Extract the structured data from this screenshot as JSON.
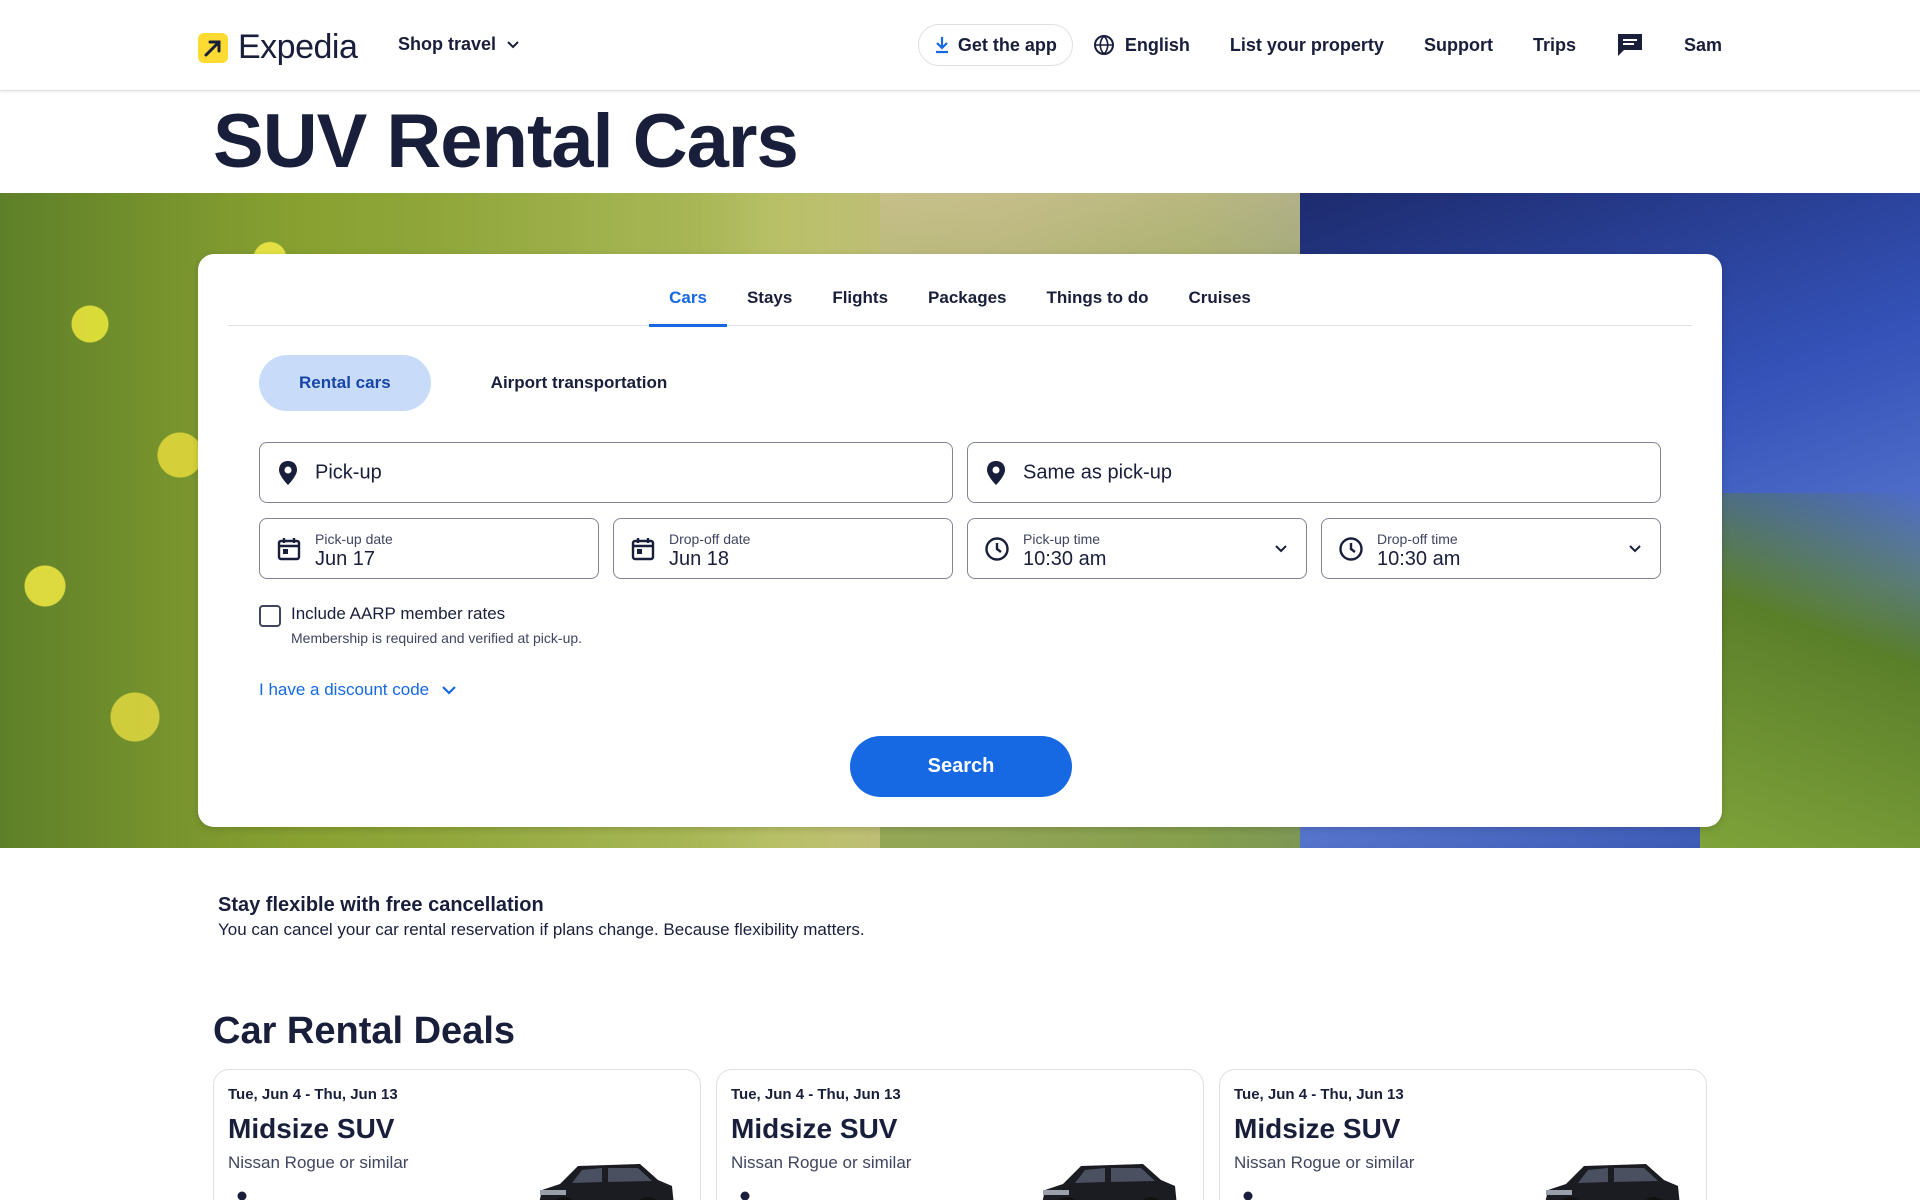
{
  "header": {
    "brand": "Expedia",
    "shop_travel": "Shop travel",
    "get_app": "Get the app",
    "language": "English",
    "list_property": "List your property",
    "support": "Support",
    "trips": "Trips",
    "user": "Sam"
  },
  "page_title": "SUV Rental Cars",
  "search": {
    "tabs": [
      "Cars",
      "Stays",
      "Flights",
      "Packages",
      "Things to do",
      "Cruises"
    ],
    "active_tab": "Cars",
    "sub_tabs": [
      "Rental cars",
      "Airport transportation"
    ],
    "active_sub_tab": "Rental cars",
    "pickup_placeholder": "Pick-up",
    "dropoff_placeholder": "Same as pick-up",
    "pickup_date": {
      "label": "Pick-up date",
      "value": "Jun 17"
    },
    "dropoff_date": {
      "label": "Drop-off date",
      "value": "Jun 18"
    },
    "pickup_time": {
      "label": "Pick-up time",
      "value": "10:30 am"
    },
    "dropoff_time": {
      "label": "Drop-off time",
      "value": "10:30 am"
    },
    "aarp_label": "Include AARP member rates",
    "aarp_note": "Membership is required and verified at pick-up.",
    "discount_link": "I have a discount code",
    "search_button": "Search"
  },
  "flexibility": {
    "title": "Stay flexible with free cancellation",
    "text": "You can cancel your car rental reservation if plans change. Because flexibility matters."
  },
  "deals": {
    "title": "Car Rental Deals",
    "items": [
      {
        "dates": "Tue, Jun 4 - Thu, Jun 13",
        "class": "Midsize SUV",
        "model": "Nissan Rogue or similar"
      },
      {
        "dates": "Tue, Jun 4 - Thu, Jun 13",
        "class": "Midsize SUV",
        "model": "Nissan Rogue or similar"
      },
      {
        "dates": "Tue, Jun 4 - Thu, Jun 13",
        "class": "Midsize SUV",
        "model": "Nissan Rogue or similar"
      }
    ]
  },
  "colors": {
    "primary": "#1668e3",
    "text": "#191e3b",
    "brand_yellow": "#fddb32",
    "active_pill": "#c8dcf9"
  },
  "icons": [
    "expedia-logo-icon",
    "chevron-down-icon",
    "download-icon",
    "globe-icon",
    "chat-icon",
    "location-pin-icon",
    "calendar-icon",
    "clock-icon",
    "person-icon"
  ]
}
